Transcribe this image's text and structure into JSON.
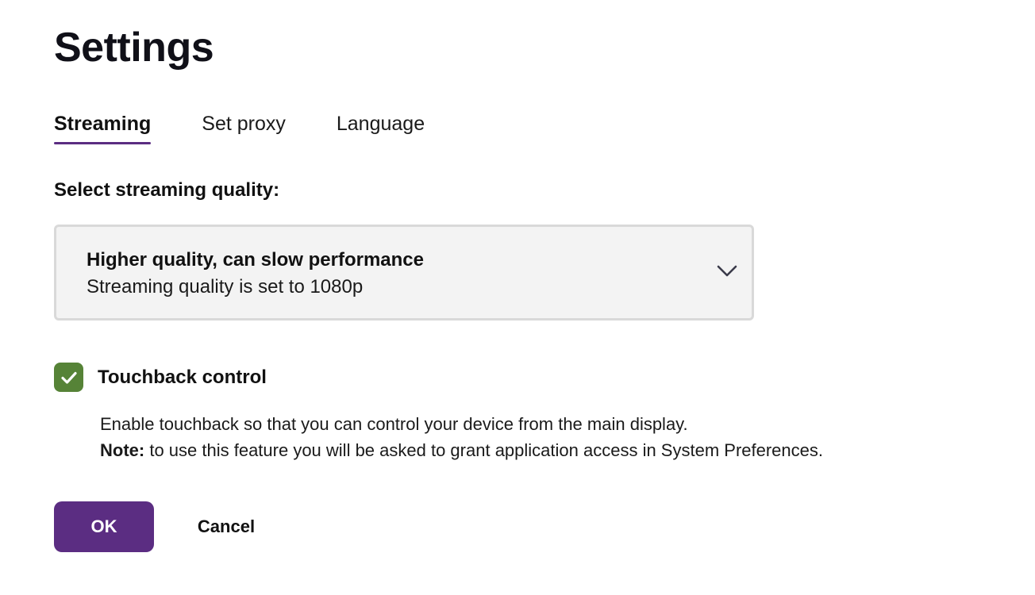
{
  "page": {
    "title": "Settings"
  },
  "tabs": [
    {
      "label": "Streaming",
      "active": true
    },
    {
      "label": "Set proxy",
      "active": false
    },
    {
      "label": "Language",
      "active": false
    }
  ],
  "streaming": {
    "section_label": "Select streaming quality:",
    "quality_select": {
      "selected_title": "Higher quality, can slow performance",
      "selected_subtitle": "Streaming quality is set to 1080p",
      "icon": "chevron-down-icon"
    },
    "touchback": {
      "checked": true,
      "label": "Touchback control",
      "icon": "checkmark-icon",
      "description": "Enable touchback so that you can control your device from the main display.",
      "note_label": "Note:",
      "note_text": " to use this feature you will be asked to grant application access in System Preferences."
    }
  },
  "actions": {
    "ok_label": "OK",
    "cancel_label": "Cancel"
  },
  "colors": {
    "accent": "#5b2d82",
    "checkbox": "#568337",
    "select_background": "#f3f3f3",
    "select_border": "#d9d9d9"
  }
}
